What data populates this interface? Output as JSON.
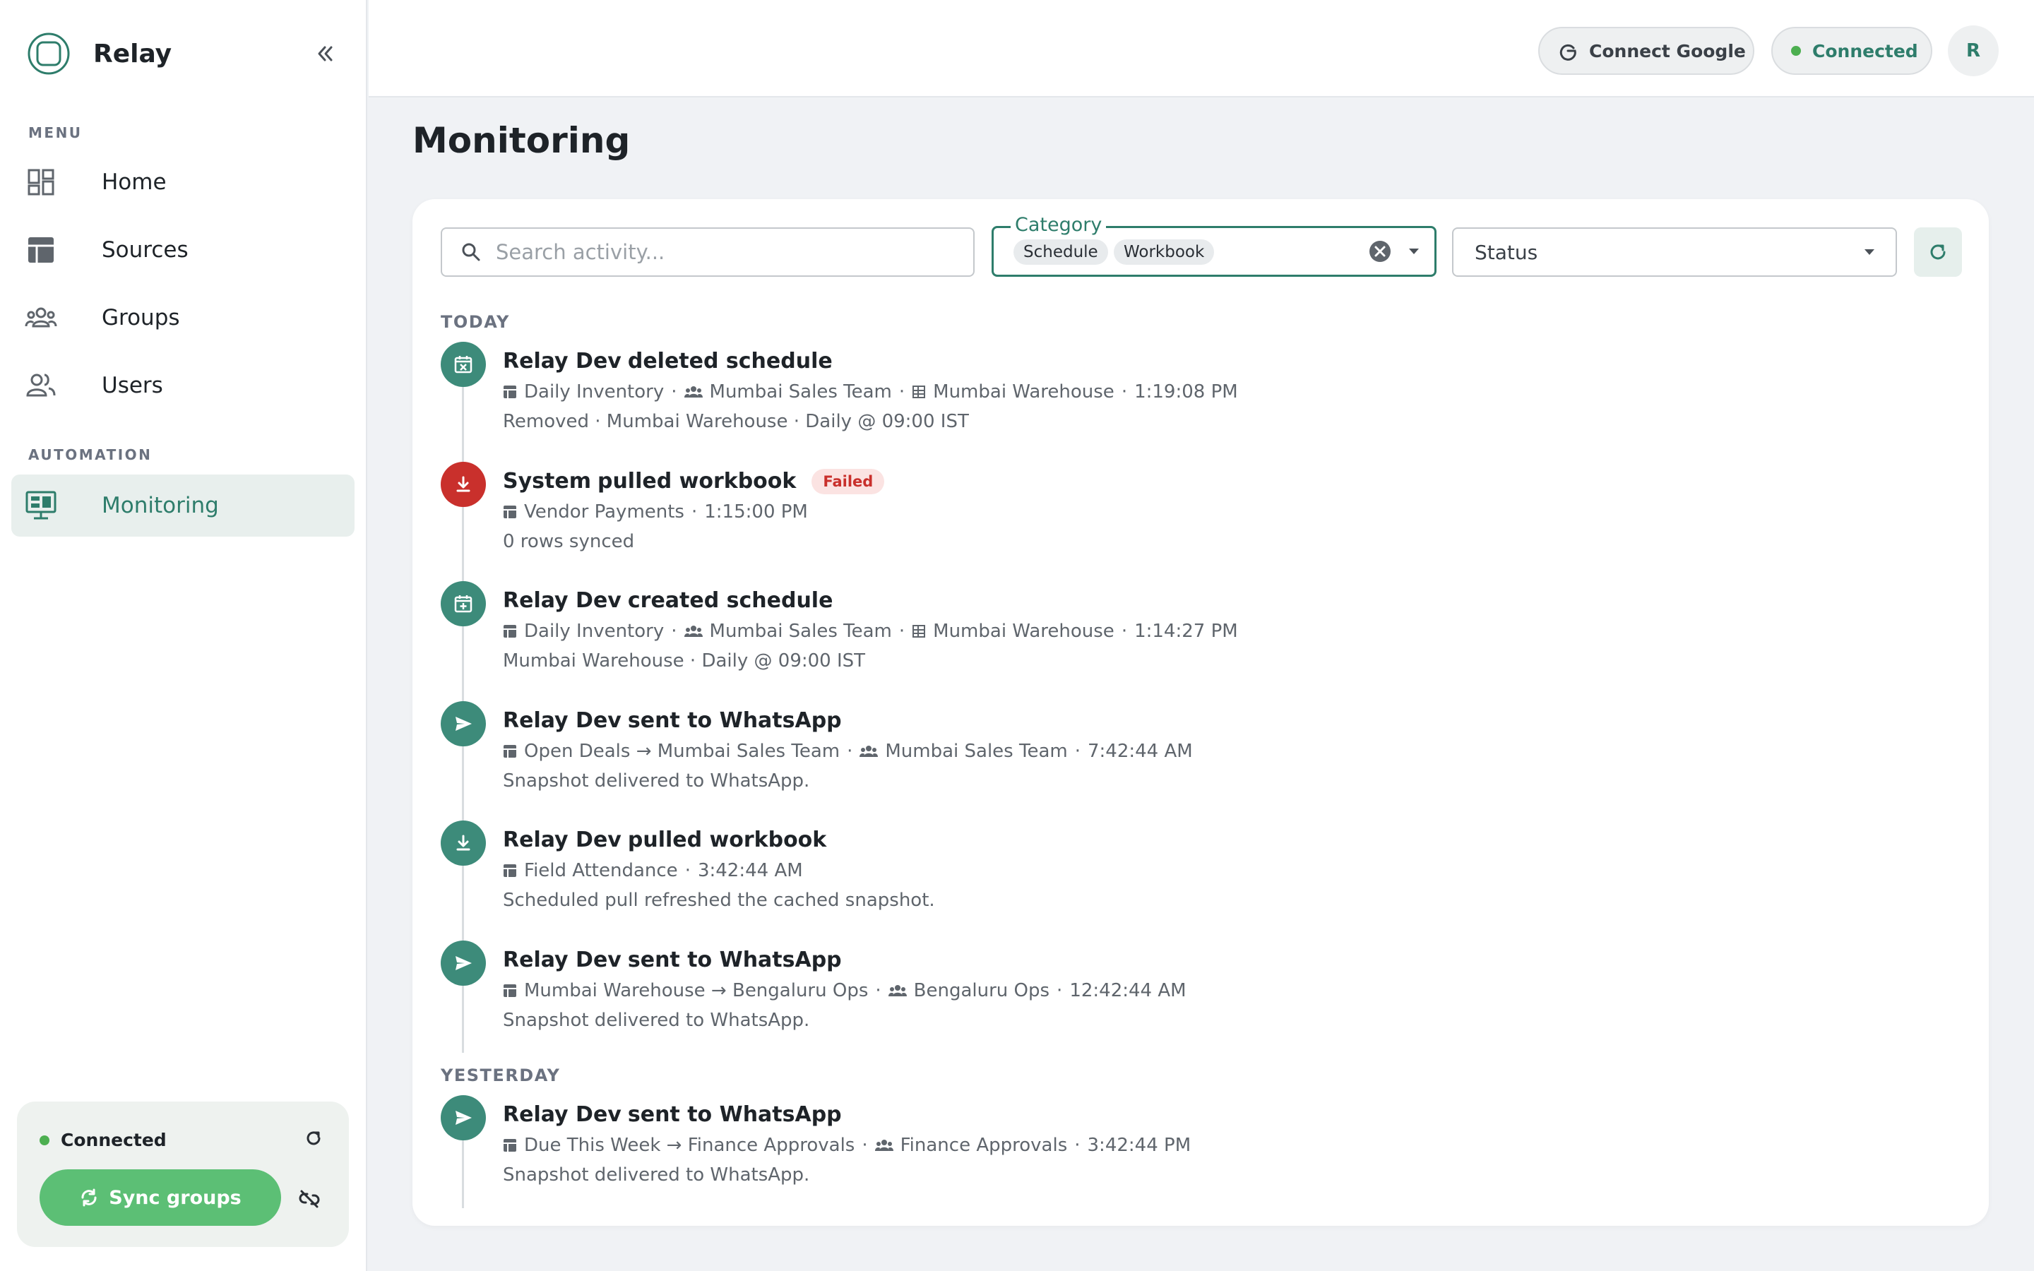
{
  "app": {
    "name": "Relay"
  },
  "sidebar": {
    "menu_title": "MENU",
    "items": [
      {
        "label": "Home",
        "icon": "dashboard-icon"
      },
      {
        "label": "Sources",
        "icon": "table-icon"
      },
      {
        "label": "Groups",
        "icon": "groups-icon"
      },
      {
        "label": "Users",
        "icon": "users-icon"
      }
    ],
    "automation_title": "AUTOMATION",
    "automation_items": [
      {
        "label": "Monitoring",
        "icon": "monitor-icon",
        "active": true
      }
    ],
    "footer": {
      "status": "Connected",
      "sync_label": "Sync groups"
    }
  },
  "topbar": {
    "connect_google": "Connect Google",
    "status": "Connected",
    "avatar": "R"
  },
  "page": {
    "title": "Monitoring"
  },
  "filters": {
    "search_placeholder": "Search activity...",
    "category_label": "Category",
    "category_chips": [
      "Schedule",
      "Workbook"
    ],
    "status_label": "Status"
  },
  "groups": [
    {
      "label": "TODAY",
      "events": [
        {
          "icon": "calendar-x-icon",
          "failed": false,
          "actor": "Relay Dev",
          "action": "deleted schedule",
          "meta": [
            {
              "icon": "sheet",
              "text": "Daily Inventory"
            },
            {
              "icon": "group",
              "text": "Mumbai Sales Team"
            },
            {
              "icon": "grid",
              "text": "Mumbai Warehouse"
            },
            {
              "text": "1:19:08 PM"
            }
          ],
          "detail": "Removed · Mumbai Warehouse · Daily @ 09:00 IST"
        },
        {
          "icon": "download-icon",
          "failed": true,
          "actor": "System",
          "action": "pulled workbook",
          "badge": "Failed",
          "meta": [
            {
              "icon": "sheet",
              "text": "Vendor Payments"
            },
            {
              "text": "1:15:00 PM"
            }
          ],
          "detail": "0 rows synced"
        },
        {
          "icon": "calendar-plus-icon",
          "failed": false,
          "actor": "Relay Dev",
          "action": "created schedule",
          "meta": [
            {
              "icon": "sheet",
              "text": "Daily Inventory"
            },
            {
              "icon": "group",
              "text": "Mumbai Sales Team"
            },
            {
              "icon": "grid",
              "text": "Mumbai Warehouse"
            },
            {
              "text": "1:14:27 PM"
            }
          ],
          "detail": "Mumbai Warehouse · Daily @ 09:00 IST"
        },
        {
          "icon": "send-icon",
          "failed": false,
          "actor": "Relay Dev",
          "action": "sent to WhatsApp",
          "meta": [
            {
              "icon": "sheet",
              "text": "Open Deals → Mumbai Sales Team"
            },
            {
              "icon": "group",
              "text": "Mumbai Sales Team"
            },
            {
              "text": "7:42:44 AM"
            }
          ],
          "detail": "Snapshot delivered to WhatsApp."
        },
        {
          "icon": "download-icon",
          "failed": false,
          "actor": "Relay Dev",
          "action": "pulled workbook",
          "meta": [
            {
              "icon": "sheet",
              "text": "Field Attendance"
            },
            {
              "text": "3:42:44 AM"
            }
          ],
          "detail": "Scheduled pull refreshed the cached snapshot."
        },
        {
          "icon": "send-icon",
          "failed": false,
          "actor": "Relay Dev",
          "action": "sent to WhatsApp",
          "meta": [
            {
              "icon": "sheet",
              "text": "Mumbai Warehouse → Bengaluru Ops"
            },
            {
              "icon": "group",
              "text": "Bengaluru Ops"
            },
            {
              "text": "12:42:44 AM"
            }
          ],
          "detail": "Snapshot delivered to WhatsApp."
        }
      ]
    },
    {
      "label": "YESTERDAY",
      "events": [
        {
          "icon": "send-icon",
          "failed": false,
          "actor": "Relay Dev",
          "action": "sent to WhatsApp",
          "meta": [
            {
              "icon": "sheet",
              "text": "Due This Week → Finance Approvals"
            },
            {
              "icon": "group",
              "text": "Finance Approvals"
            },
            {
              "text": "3:42:44 PM"
            }
          ],
          "detail": "Snapshot delivered to WhatsApp."
        }
      ]
    }
  ],
  "colors": {
    "accent": "#2e7d6b",
    "event_icon": "#3d8b7a",
    "failed": "#c9302c",
    "success": "#4caf50",
    "sync_button": "#5cbf75"
  }
}
